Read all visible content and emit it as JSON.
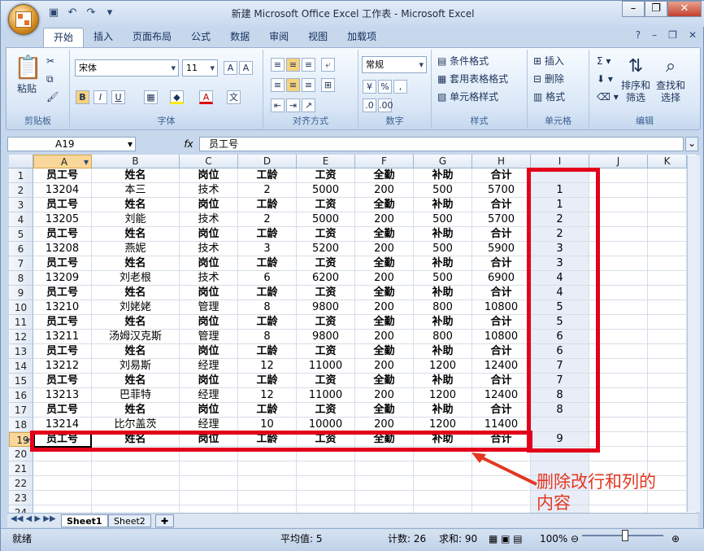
{
  "window": {
    "title": "新建 Microsoft Office Excel 工作表 - Microsoft Excel"
  },
  "ribbon": {
    "tabs": [
      "开始",
      "插入",
      "页面布局",
      "公式",
      "数据",
      "审阅",
      "视图",
      "加载项"
    ],
    "groups": {
      "clipboard": {
        "label": "剪贴板",
        "paste": "粘贴"
      },
      "font": {
        "label": "字体",
        "family": "宋体",
        "size": "11"
      },
      "alignment": {
        "label": "对齐方式"
      },
      "number": {
        "label": "数字",
        "format": "常规"
      },
      "styles": {
        "label": "样式",
        "conditional": "条件格式",
        "table": "套用表格格式",
        "cell": "单元格样式"
      },
      "cells": {
        "label": "单元格",
        "insert": "插入",
        "delete": "删除",
        "format": "格式"
      },
      "editing": {
        "label": "编辑",
        "sort": "排序和",
        "filter": "筛选",
        "find": "查找和",
        "select": "选择"
      }
    }
  },
  "formula_bar": {
    "name_box": "A19",
    "fx": "fx",
    "content": "员工号"
  },
  "columns": [
    "A",
    "B",
    "C",
    "D",
    "E",
    "F",
    "G",
    "H",
    "I",
    "J",
    "K"
  ],
  "rows": [
    [
      "员工号",
      "姓名",
      "岗位",
      "工龄",
      "工资",
      "全勤",
      "补助",
      "合计",
      ""
    ],
    [
      "13204",
      "本三",
      "技术",
      "2",
      "5000",
      "200",
      "500",
      "5700",
      "1"
    ],
    [
      "员工号",
      "姓名",
      "岗位",
      "工龄",
      "工资",
      "全勤",
      "补助",
      "合计",
      "1"
    ],
    [
      "13205",
      "刘能",
      "技术",
      "2",
      "5000",
      "200",
      "500",
      "5700",
      "2"
    ],
    [
      "员工号",
      "姓名",
      "岗位",
      "工龄",
      "工资",
      "全勤",
      "补助",
      "合计",
      "2"
    ],
    [
      "13208",
      "燕妮",
      "技术",
      "3",
      "5200",
      "200",
      "500",
      "5900",
      "3"
    ],
    [
      "员工号",
      "姓名",
      "岗位",
      "工龄",
      "工资",
      "全勤",
      "补助",
      "合计",
      "3"
    ],
    [
      "13209",
      "刘老根",
      "技术",
      "6",
      "6200",
      "200",
      "500",
      "6900",
      "4"
    ],
    [
      "员工号",
      "姓名",
      "岗位",
      "工龄",
      "工资",
      "全勤",
      "补助",
      "合计",
      "4"
    ],
    [
      "13210",
      "刘姥姥",
      "管理",
      "8",
      "9800",
      "200",
      "800",
      "10800",
      "5"
    ],
    [
      "员工号",
      "姓名",
      "岗位",
      "工龄",
      "工资",
      "全勤",
      "补助",
      "合计",
      "5"
    ],
    [
      "13211",
      "汤姆汉克斯",
      "管理",
      "8",
      "9800",
      "200",
      "800",
      "10800",
      "6"
    ],
    [
      "员工号",
      "姓名",
      "岗位",
      "工龄",
      "工资",
      "全勤",
      "补助",
      "合计",
      "6"
    ],
    [
      "13212",
      "刘易斯",
      "经理",
      "12",
      "11000",
      "200",
      "1200",
      "12400",
      "7"
    ],
    [
      "员工号",
      "姓名",
      "岗位",
      "工龄",
      "工资",
      "全勤",
      "补助",
      "合计",
      "7"
    ],
    [
      "13213",
      "巴菲特",
      "经理",
      "12",
      "11000",
      "200",
      "1200",
      "12400",
      "8"
    ],
    [
      "员工号",
      "姓名",
      "岗位",
      "工龄",
      "工资",
      "全勤",
      "补助",
      "合计",
      "8"
    ],
    [
      "13214",
      "比尔盖茨",
      "经理",
      "10",
      "10000",
      "200",
      "1200",
      "11400",
      ""
    ],
    [
      "员工号",
      "姓名",
      "岗位",
      "工龄",
      "工资",
      "全勤",
      "补助",
      "合计",
      "9"
    ],
    [
      "",
      "",
      "",
      "",
      "",
      "",
      "",
      "",
      ""
    ],
    [
      "",
      "",
      "",
      "",
      "",
      "",
      "",
      "",
      ""
    ],
    [
      "",
      "",
      "",
      "",
      "",
      "",
      "",
      "",
      ""
    ],
    [
      "",
      "",
      "",
      "",
      "",
      "",
      "",
      "",
      ""
    ],
    [
      "",
      "",
      "",
      "",
      "",
      "",
      "",
      "",
      ""
    ]
  ],
  "annotation": {
    "text": "删除改行和列的内容"
  },
  "sheets": [
    "Sheet1",
    "Sheet2"
  ],
  "status": {
    "ready": "就绪",
    "average": "平均值: 5",
    "count": "计数: 26",
    "sum": "求和: 90",
    "zoom": "100%"
  }
}
